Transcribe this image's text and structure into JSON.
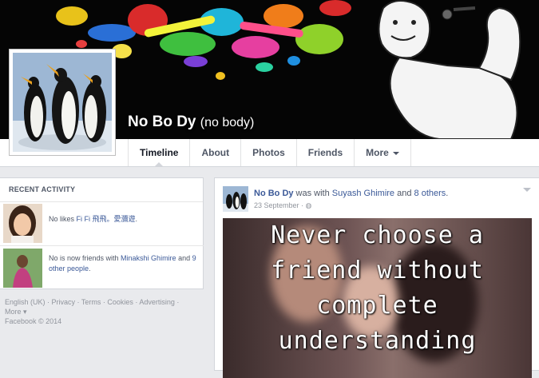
{
  "profile": {
    "name": "No Bo Dy",
    "nickname": "(no body)"
  },
  "nav": {
    "tabs": [
      "Timeline",
      "About",
      "Photos",
      "Friends",
      "More"
    ]
  },
  "recent_activity": {
    "title": "RECENT ACTIVITY",
    "items": [
      {
        "prefix": "No likes ",
        "link": "Fi Fi 飛飛。愛瀰遊",
        "suffix": "."
      },
      {
        "prefix": "No is now friends with ",
        "link": "Minakshi Ghimire",
        "middle": " and ",
        "link2": "9 other people",
        "suffix": "."
      }
    ]
  },
  "footer": {
    "line1": "English (UK) · Privacy · Terms · Cookies · Advertising ·",
    "line2": "More ▾",
    "line3": "Facebook © 2014"
  },
  "post": {
    "author": "No Bo Dy",
    "with_text": " was with ",
    "tagged": "Suyash Ghimire",
    "and_text": " and ",
    "others": "8 others",
    "end": ".",
    "date": "23 September · ",
    "privacy_icon": "globe-icon",
    "image_text": [
      "Never choose a",
      "friend without",
      "complete",
      "understanding"
    ]
  },
  "colors": {
    "link": "#3b5998",
    "page_bg": "#e9eaed",
    "cover_bg": "#050505"
  }
}
